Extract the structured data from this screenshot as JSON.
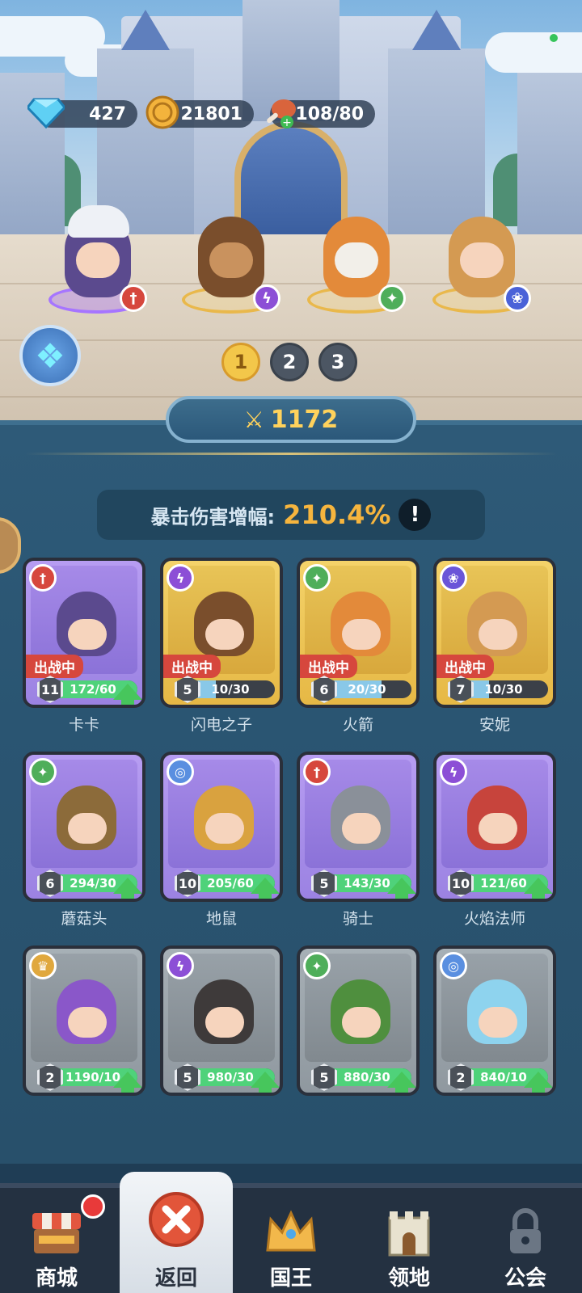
{
  "resources": {
    "gems": "427",
    "coins": "21801",
    "stamina": "108/80"
  },
  "team_tabs": [
    "1",
    "2",
    "3"
  ],
  "active_team": "1",
  "power": "1172",
  "crit": {
    "label": "暴击伤害增幅:",
    "value": "210.4%",
    "info": "!"
  },
  "deployed_tag": "出战中",
  "heroes": [
    {
      "name": "卡卡",
      "level": "11",
      "progress": "172/60",
      "rarity": "purple",
      "class_color": "#d6473d",
      "class_icon": "sword-class-icon",
      "deployed": true,
      "upgradable": true
    },
    {
      "name": "闪电之子",
      "level": "5",
      "progress": "10/30",
      "rarity": "gold",
      "class_color": "#8c4fd6",
      "class_icon": "magic-class-icon",
      "deployed": true,
      "upgradable": false
    },
    {
      "name": "火箭",
      "level": "6",
      "progress": "20/30",
      "rarity": "gold",
      "class_color": "#4fae5a",
      "class_icon": "star-class-icon",
      "deployed": true,
      "upgradable": false
    },
    {
      "name": "安妮",
      "level": "7",
      "progress": "10/30",
      "rarity": "gold",
      "class_color": "#6a55d8",
      "class_icon": "paw-class-icon",
      "deployed": true,
      "upgradable": false
    },
    {
      "name": "蘑菇头",
      "level": "6",
      "progress": "294/30",
      "rarity": "purple",
      "class_color": "#4fae5a",
      "class_icon": "star-class-icon",
      "deployed": false,
      "upgradable": true
    },
    {
      "name": "地鼠",
      "level": "10",
      "progress": "205/60",
      "rarity": "purple",
      "class_color": "#5a8fe0",
      "class_icon": "spiral-class-icon",
      "deployed": false,
      "upgradable": true
    },
    {
      "name": "骑士",
      "level": "5",
      "progress": "143/30",
      "rarity": "purple",
      "class_color": "#d6473d",
      "class_icon": "sword-class-icon",
      "deployed": false,
      "upgradable": true
    },
    {
      "name": "火焰法师",
      "level": "10",
      "progress": "121/60",
      "rarity": "purple",
      "class_color": "#8c4fd6",
      "class_icon": "magic-class-icon",
      "deployed": false,
      "upgradable": true
    },
    {
      "name": "",
      "level": "2",
      "progress": "1190/10",
      "rarity": "gray",
      "class_color": "#e0a83e",
      "class_icon": "crown-class-icon",
      "deployed": false,
      "upgradable": true
    },
    {
      "name": "",
      "level": "5",
      "progress": "980/30",
      "rarity": "gray",
      "class_color": "#8c4fd6",
      "class_icon": "magic-class-icon",
      "deployed": false,
      "upgradable": true
    },
    {
      "name": "",
      "level": "5",
      "progress": "880/30",
      "rarity": "gray",
      "class_color": "#4fae5a",
      "class_icon": "star-class-icon",
      "deployed": false,
      "upgradable": true
    },
    {
      "name": "",
      "level": "2",
      "progress": "840/10",
      "rarity": "gray",
      "class_color": "#5a8fe0",
      "class_icon": "spiral-class-icon",
      "deployed": false,
      "upgradable": true
    }
  ],
  "nav": {
    "shop": "商城",
    "back": "返回",
    "king": "国王",
    "territory": "领地",
    "guild": "公会"
  }
}
